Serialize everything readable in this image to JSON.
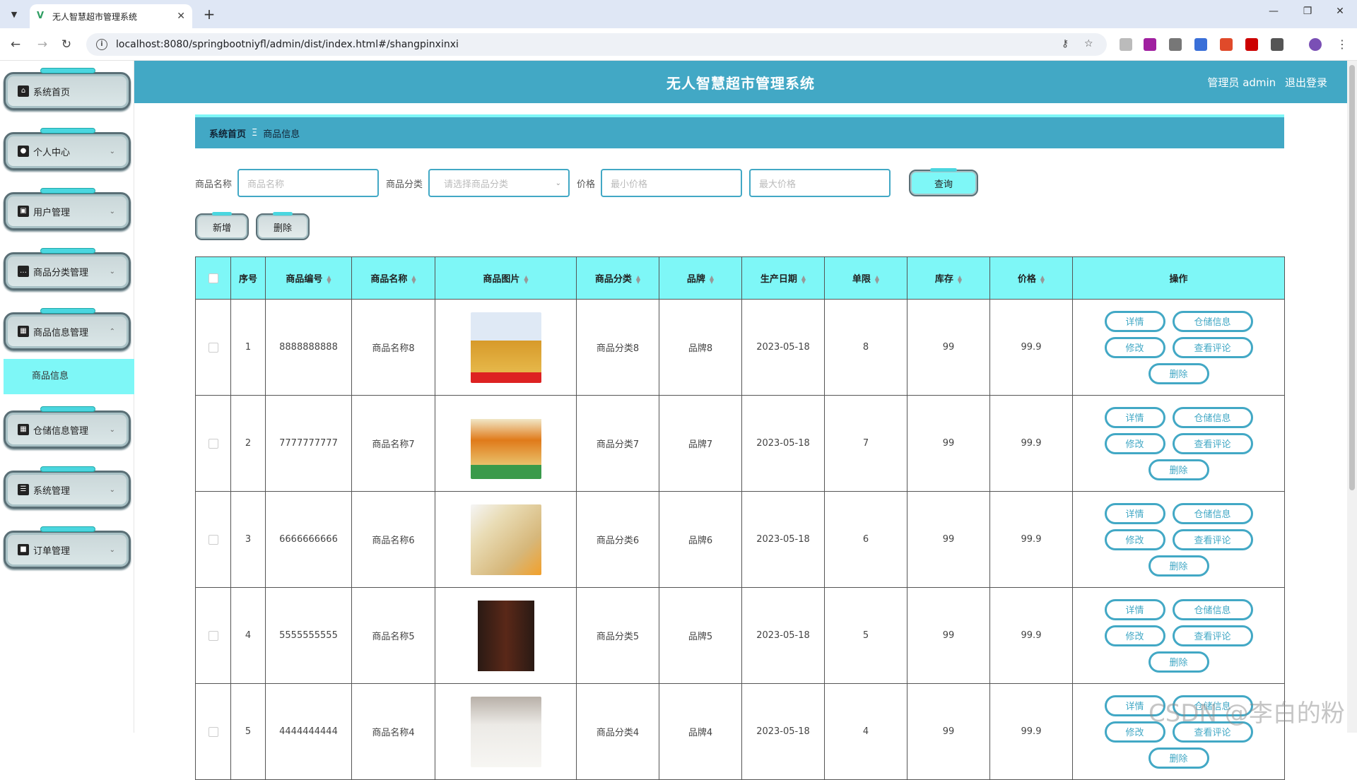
{
  "browser": {
    "tab_title": "无人智慧超市管理系统",
    "url": "localhost:8080/springbootniyfl/admin/dist/index.html#/shangpinxinxi"
  },
  "header": {
    "title": "无人智慧超市管理系统",
    "user": "管理员 admin",
    "logout": "退出登录"
  },
  "sidebar": {
    "items": [
      {
        "label": "系统首页",
        "icon": "home-icon"
      },
      {
        "label": "个人中心",
        "icon": "user-icon"
      },
      {
        "label": "用户管理",
        "icon": "briefcase-icon"
      },
      {
        "label": "商品分类管理",
        "icon": "chat-icon"
      },
      {
        "label": "商品信息管理",
        "icon": "grid-icon"
      },
      {
        "label": "仓储信息管理",
        "icon": "grid-icon"
      },
      {
        "label": "系统管理",
        "icon": "doc-icon"
      },
      {
        "label": "订单管理",
        "icon": "sign-icon"
      }
    ],
    "submenu_active": "商品信息"
  },
  "breadcrumb": {
    "home": "系统首页",
    "sep": "Ξ",
    "current": "商品信息"
  },
  "search": {
    "name_label": "商品名称",
    "name_placeholder": "商品名称",
    "category_label": "商品分类",
    "category_placeholder": "请选择商品分类",
    "price_label": "价格",
    "min_placeholder": "最小价格",
    "max_placeholder": "最大价格",
    "query_button": "查询"
  },
  "actions": {
    "add": "新增",
    "delete": "删除"
  },
  "table": {
    "headers": [
      "序号",
      "商品编号",
      "商品名称",
      "商品图片",
      "商品分类",
      "品牌",
      "生产日期",
      "单限",
      "库存",
      "价格",
      "操作"
    ],
    "op_labels": {
      "detail": "详情",
      "storage": "仓储信息",
      "edit": "修改",
      "comments": "查看评论",
      "delete": "删除"
    },
    "rows": [
      {
        "no": "1",
        "code": "8888888888",
        "name": "商品名称8",
        "category": "商品分类8",
        "brand": "品牌8",
        "date": "2023-05-18",
        "limit": "8",
        "stock": "99",
        "price": "99.9",
        "img": "rice-bag"
      },
      {
        "no": "2",
        "code": "7777777777",
        "name": "商品名称7",
        "category": "商品分类7",
        "brand": "品牌7",
        "date": "2023-05-18",
        "limit": "7",
        "stock": "99",
        "price": "99.9",
        "img": "cooking-wine"
      },
      {
        "no": "3",
        "code": "6666666666",
        "name": "商品名称6",
        "category": "商品分类6",
        "brand": "品牌6",
        "date": "2023-05-18",
        "limit": "6",
        "stock": "99",
        "price": "99.9",
        "img": "seasoning-box"
      },
      {
        "no": "4",
        "code": "5555555555",
        "name": "商品名称5",
        "category": "商品分类5",
        "brand": "品牌5",
        "date": "2023-05-18",
        "limit": "5",
        "stock": "99",
        "price": "99.9",
        "img": "soy-sauce"
      },
      {
        "no": "5",
        "code": "4444444444",
        "name": "商品名称4",
        "category": "商品分类4",
        "brand": "品牌4",
        "date": "2023-05-18",
        "limit": "4",
        "stock": "99",
        "price": "99.9",
        "img": "flour-bag"
      }
    ]
  },
  "watermark": "CSDN @李白的粉",
  "colors": {
    "accent": "#42a8c5",
    "cyan": "#7ef7f7"
  }
}
